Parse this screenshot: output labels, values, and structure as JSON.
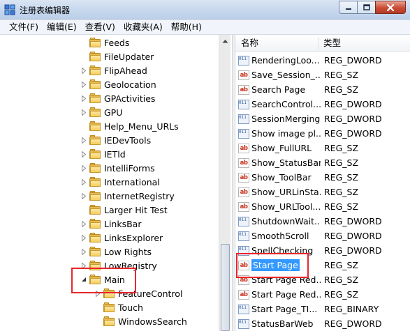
{
  "window": {
    "title": "注册表编辑器",
    "controls": {
      "minimize": "minimize",
      "maximize": "maximize",
      "close": "close"
    }
  },
  "menu": [
    "文件(F)",
    "编辑(E)",
    "查看(V)",
    "收藏夹(A)",
    "帮助(H)"
  ],
  "tree": [
    {
      "label": "Feeds",
      "expandable": false,
      "indent": 0
    },
    {
      "label": "FileUpdater",
      "expandable": false,
      "indent": 0
    },
    {
      "label": "FlipAhead",
      "expandable": true,
      "indent": 0
    },
    {
      "label": "Geolocation",
      "expandable": true,
      "indent": 0
    },
    {
      "label": "GPActivities",
      "expandable": true,
      "indent": 0
    },
    {
      "label": "GPU",
      "expandable": true,
      "indent": 0
    },
    {
      "label": "Help_Menu_URLs",
      "expandable": false,
      "indent": 0
    },
    {
      "label": "IEDevTools",
      "expandable": true,
      "indent": 0
    },
    {
      "label": "IETld",
      "expandable": true,
      "indent": 0
    },
    {
      "label": "IntelliForms",
      "expandable": true,
      "indent": 0
    },
    {
      "label": "International",
      "expandable": true,
      "indent": 0
    },
    {
      "label": "InternetRegistry",
      "expandable": true,
      "indent": 0
    },
    {
      "label": "Larger Hit Test",
      "expandable": false,
      "indent": 0
    },
    {
      "label": "LinksBar",
      "expandable": true,
      "indent": 0
    },
    {
      "label": "LinksExplorer",
      "expandable": true,
      "indent": 0
    },
    {
      "label": "Low Rights",
      "expandable": true,
      "indent": 0
    },
    {
      "label": "LowRegistry",
      "expandable": true,
      "indent": 0
    },
    {
      "label": "Main",
      "expandable": true,
      "expanded": true,
      "indent": 0
    },
    {
      "label": "FeatureControl",
      "expandable": true,
      "indent": 1
    },
    {
      "label": "Touch",
      "expandable": false,
      "indent": 1
    },
    {
      "label": "WindowsSearch",
      "expandable": false,
      "indent": 1
    }
  ],
  "list": {
    "headers": {
      "name": "名称",
      "type": "类型"
    },
    "rows": [
      {
        "name": "RenderingLoo...",
        "type": "REG_DWORD",
        "icon": "binary"
      },
      {
        "name": "Save_Session_...",
        "type": "REG_SZ",
        "icon": "string"
      },
      {
        "name": "Search Page",
        "type": "REG_SZ",
        "icon": "string"
      },
      {
        "name": "SearchControl...",
        "type": "REG_DWORD",
        "icon": "binary"
      },
      {
        "name": "SessionMerging",
        "type": "REG_DWORD",
        "icon": "binary"
      },
      {
        "name": "Show image pl...",
        "type": "REG_DWORD",
        "icon": "binary"
      },
      {
        "name": "Show_FullURL",
        "type": "REG_SZ",
        "icon": "string"
      },
      {
        "name": "Show_StatusBar",
        "type": "REG_SZ",
        "icon": "string"
      },
      {
        "name": "Show_ToolBar",
        "type": "REG_SZ",
        "icon": "string"
      },
      {
        "name": "Show_URLinSta...",
        "type": "REG_SZ",
        "icon": "string"
      },
      {
        "name": "Show_URLTool...",
        "type": "REG_SZ",
        "icon": "string"
      },
      {
        "name": "ShutdownWait...",
        "type": "REG_DWORD",
        "icon": "binary"
      },
      {
        "name": "SmoothScroll",
        "type": "REG_DWORD",
        "icon": "binary"
      },
      {
        "name": "SpellChecking",
        "type": "REG_DWORD",
        "icon": "binary"
      },
      {
        "name": "Start Page",
        "type": "REG_SZ",
        "icon": "string",
        "selected": true
      },
      {
        "name": "Start Page Red...",
        "type": "REG_SZ",
        "icon": "string"
      },
      {
        "name": "Start Page Red...",
        "type": "REG_SZ",
        "icon": "string"
      },
      {
        "name": "Start Page_TI...",
        "type": "REG_BINARY",
        "icon": "binary"
      },
      {
        "name": "StatusBarWeb",
        "type": "REG_DWORD",
        "icon": "binary"
      }
    ]
  },
  "icons": {
    "string": "ab",
    "binary": "011 110 101"
  },
  "colors": {
    "selection": "#3399ff",
    "highlight_box": "#e8262a",
    "folder": "#f5cd5c"
  }
}
